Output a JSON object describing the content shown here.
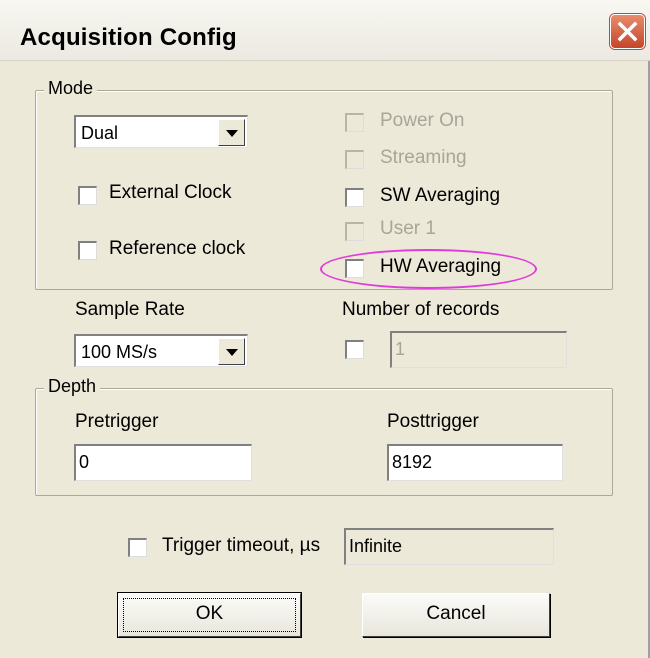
{
  "window": {
    "title": "Acquisition Config",
    "close_icon": "close-icon"
  },
  "mode": {
    "label": "Mode",
    "mode_select": "Dual",
    "external_clock": "External Clock",
    "reference_clock": "Reference clock",
    "power_on": "Power On",
    "streaming": "Streaming",
    "sw_averaging": "SW Averaging",
    "user1": "User 1",
    "hw_averaging": "HW Averaging"
  },
  "sample_rate": {
    "label": "Sample Rate",
    "value": "100 MS/s"
  },
  "records": {
    "label": "Number of records",
    "value": "1"
  },
  "depth": {
    "label": "Depth",
    "pretrigger_label": "Pretrigger",
    "pretrigger_value": "0",
    "posttrigger_label": "Posttrigger",
    "posttrigger_value": "8192"
  },
  "trigger": {
    "label": "Trigger timeout, µs",
    "value": "Infinite"
  },
  "buttons": {
    "ok": "OK",
    "cancel": "Cancel"
  },
  "colors": {
    "highlight_ring": "#e13bdd",
    "dialog_bg": "#ece9d8"
  }
}
